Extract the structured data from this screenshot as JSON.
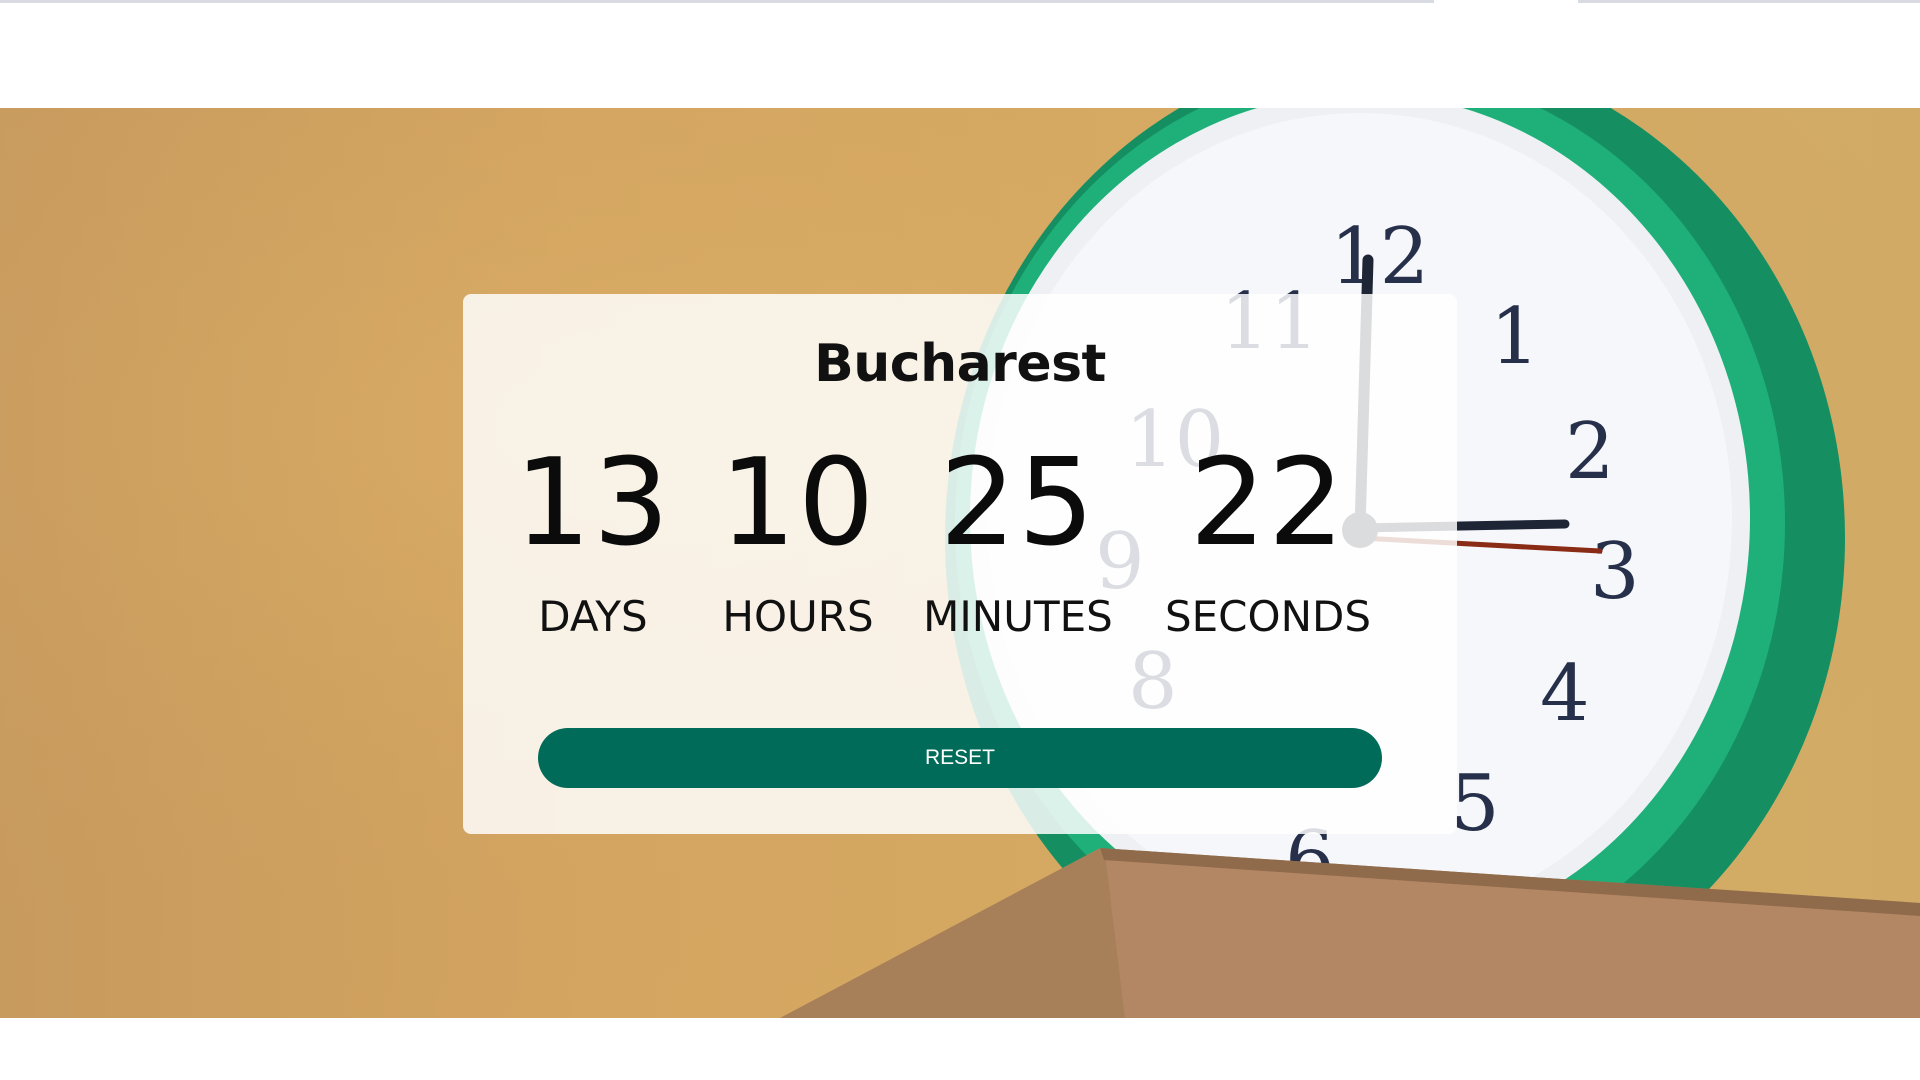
{
  "city": "Bucharest",
  "countdown": {
    "days": "13",
    "hours": "10",
    "minutes": "25",
    "seconds": "22",
    "days_label": "DAYS",
    "hours_label": "HOURS",
    "minutes_label": "MINUTES",
    "seconds_label": "SECONDS"
  },
  "reset_label": "RESET",
  "colors": {
    "accent": "#016b59",
    "hero_background": "#d4a560",
    "clock_body": "#1aa36f"
  }
}
